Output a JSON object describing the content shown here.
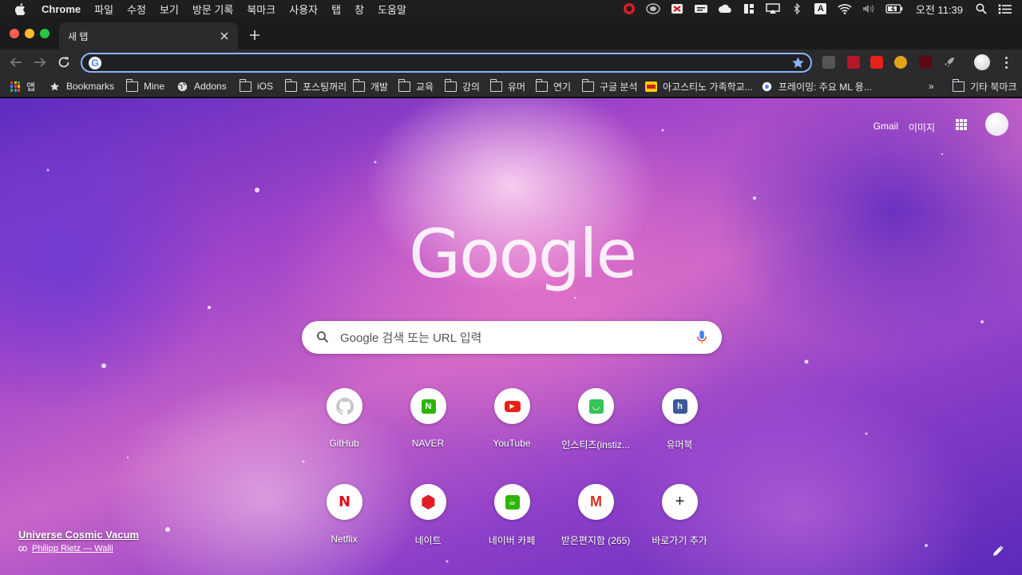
{
  "menubar": {
    "app_name": "Chrome",
    "items": [
      "파일",
      "수정",
      "보기",
      "방문 기록",
      "북마크",
      "사용자",
      "탭",
      "창",
      "도움말"
    ],
    "status_icons": [
      "creative-cloud-icon",
      "drive-sync-icon",
      "adblock-icon",
      "menubar-app-icon",
      "cloud-icon",
      "split-view-icon",
      "airplay-icon",
      "bluetooth-icon",
      "input-source-icon",
      "wifi-icon",
      "volume-icon",
      "battery-icon"
    ],
    "input_source_label": "A",
    "clock": "오전 11:39"
  },
  "tabstrip": {
    "tab_title": "새 탭"
  },
  "toolbar": {
    "omnibox_value": ""
  },
  "bookmarks": {
    "apps": "앱",
    "items": [
      {
        "label": "Bookmarks",
        "icon": "star-icon"
      },
      {
        "label": "Mine",
        "icon": "folder-icon"
      },
      {
        "label": "Addons",
        "icon": "globe-icon"
      },
      {
        "label": "iOS",
        "icon": "folder-icon"
      },
      {
        "label": "포스팅꺼리",
        "icon": "folder-icon"
      },
      {
        "label": "개발",
        "icon": "folder-icon"
      },
      {
        "label": "교육",
        "icon": "folder-icon"
      },
      {
        "label": "강의",
        "icon": "folder-icon"
      },
      {
        "label": "유머",
        "icon": "folder-icon"
      },
      {
        "label": "연기",
        "icon": "folder-icon"
      },
      {
        "label": "구글 분석",
        "icon": "folder-icon"
      },
      {
        "label": "아고스티노 가족학교...",
        "icon": "site-icon"
      },
      {
        "label": "프레이밍: 주요 ML 용...",
        "icon": "site-icon"
      }
    ],
    "overflow": "»",
    "other": "기타 북마크"
  },
  "ntp": {
    "links": {
      "gmail": "Gmail",
      "images": "이미지"
    },
    "search_placeholder": "Google 검색 또는 URL 입력",
    "logo_text": "Google",
    "tiles": [
      {
        "title": "GitHub",
        "icon": "github-icon",
        "color": "#c7c7c7",
        "glyph": ""
      },
      {
        "title": "NAVER",
        "icon": "naver-icon",
        "color": "#2db400",
        "glyph": "N"
      },
      {
        "title": "YouTube",
        "icon": "youtube-icon",
        "color": "#e62117",
        "glyph": "▶"
      },
      {
        "title": "인스티즈(instiz...",
        "icon": "instiz-icon",
        "color": "#35c35a",
        "glyph": "◡"
      },
      {
        "title": "유머북",
        "icon": "humorbook-icon",
        "color": "#3c5a99",
        "glyph": "h"
      },
      {
        "title": "Netflix",
        "icon": "netflix-icon",
        "color": "#ffffff",
        "glyph": "N"
      },
      {
        "title": "네이트",
        "icon": "nate-icon",
        "color": "#e21b24",
        "glyph": "⬢"
      },
      {
        "title": "네이버 카페",
        "icon": "naver-cafe-icon",
        "color": "#2db400",
        "glyph": "☕"
      },
      {
        "title": "받은편지함 (265)",
        "icon": "gmail-icon",
        "color": "#ffffff",
        "glyph": "M"
      },
      {
        "title": "바로가기 추가",
        "icon": "add-shortcut-icon",
        "color": "#ffffff",
        "glyph": "+"
      }
    ],
    "attribution": {
      "title": "Universe Cosmic Vacum",
      "author": "Philipp Rietz — Walli"
    }
  },
  "colors": {
    "menubar_bg": "#1e1e1e",
    "tabstrip_bg": "#1b1b1b",
    "toolbar_bg": "#2b2b2e",
    "omnibox_border": "#8ab4f8",
    "traffic_red": "#ff5f57",
    "traffic_yellow": "#febc2e",
    "traffic_green": "#28c840"
  }
}
